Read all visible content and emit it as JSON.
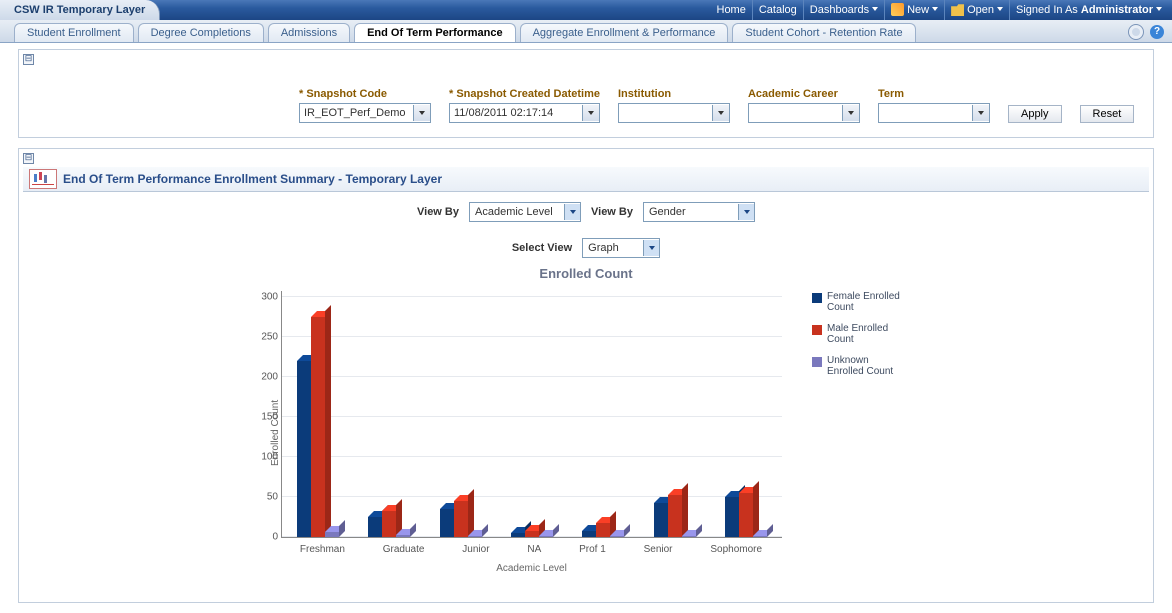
{
  "app_title": "CSW IR Temporary Layer",
  "topbar": {
    "home": "Home",
    "catalog": "Catalog",
    "dashboards": "Dashboards",
    "new": "New",
    "open": "Open",
    "signed_in_prefix": "Signed In As",
    "user": "Administrator"
  },
  "tabs": {
    "items": [
      "Student Enrollment",
      "Degree Completions",
      "Admissions",
      "End Of Term Performance",
      "Aggregate Enrollment & Performance",
      "Student Cohort - Retention Rate"
    ],
    "active_index": 3
  },
  "filters": {
    "snapshot_code_label": "* Snapshot Code",
    "snapshot_code_value": "IR_EOT_Perf_Demo",
    "snapshot_datetime_label": "* Snapshot Created Datetime",
    "snapshot_datetime_value": "11/08/2011 02:17:14",
    "institution_label": "Institution",
    "institution_value": "",
    "career_label": "Academic Career",
    "career_value": "",
    "term_label": "Term",
    "term_value": "",
    "apply": "Apply",
    "reset": "Reset"
  },
  "section": {
    "title": "End Of Term Performance Enrollment Summary - Temporary Layer"
  },
  "view": {
    "viewby_label": "View By",
    "viewby1_value": "Academic Level",
    "viewby2_value": "Gender",
    "selectview_label": "Select View",
    "selectview_value": "Graph"
  },
  "chart_data": {
    "type": "bar",
    "title": "Enrolled Count",
    "xlabel": "Academic Level",
    "ylabel": "Enrolled Count",
    "ylim": [
      0,
      300
    ],
    "yticks": [
      0,
      50,
      100,
      150,
      200,
      250,
      300
    ],
    "categories": [
      "Freshman",
      "Graduate",
      "Junior",
      "NA",
      "Prof 1",
      "Senior",
      "Sophomore"
    ],
    "series": [
      {
        "name": "Female Enrolled Count",
        "color": "#0b3b7a",
        "values": [
          220,
          25,
          35,
          5,
          8,
          42,
          50
        ]
      },
      {
        "name": "Male Enrolled Count",
        "color": "#c8321e",
        "values": [
          275,
          32,
          45,
          8,
          18,
          52,
          55
        ]
      },
      {
        "name": "Unknown Enrolled Count",
        "color": "#7a78bd",
        "values": [
          6,
          2,
          1,
          0,
          0,
          0,
          1
        ]
      }
    ],
    "legend_position": "right"
  },
  "collapse_glyph": "⊟",
  "help_glyph": "?"
}
